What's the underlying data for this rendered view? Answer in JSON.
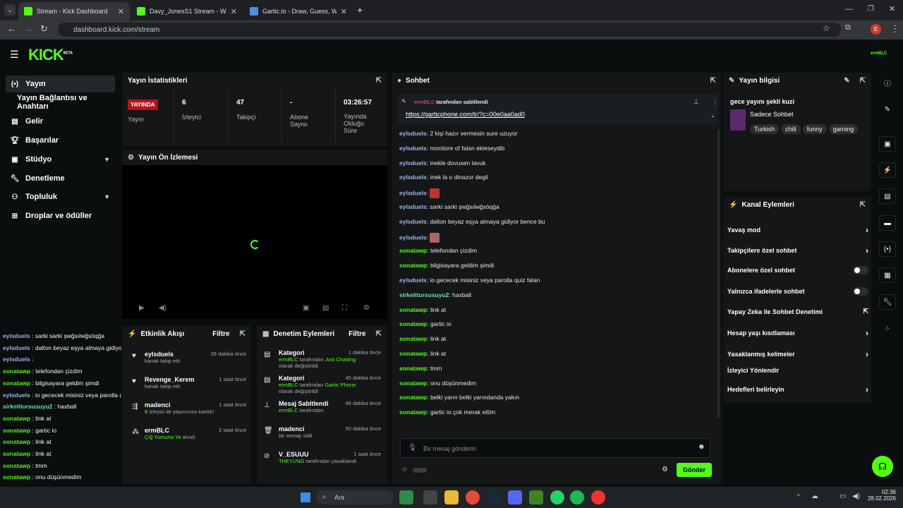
{
  "browser": {
    "tabs": [
      {
        "title": "Stream - Kick Dashboard",
        "color": "#53fc18"
      },
      {
        "title": "Davy_JonesS1 Stream - Watch L",
        "color": "#53fc18"
      },
      {
        "title": "Gartic.io - Draw, Guess, WIN",
        "color": "#4a8fe7"
      }
    ],
    "url": "dashboard.kick.com/stream",
    "profile_initial": "E"
  },
  "kick": {
    "logo": "KICK",
    "beta": "BETA",
    "user_badge": "ermBLC"
  },
  "sidebar": {
    "items": [
      {
        "label": "Yayın",
        "icon": "broadcast-icon"
      },
      {
        "label": "Yayın Bağlantısı ve Anahtarı",
        "icon": ""
      },
      {
        "label": "Gelir",
        "icon": "money-icon"
      },
      {
        "label": "Başarılar",
        "icon": "trophy-icon"
      },
      {
        "label": "Stüdyo",
        "icon": "studio-icon"
      },
      {
        "label": "Denetleme",
        "icon": "wrench-icon"
      },
      {
        "label": "Topluluk",
        "icon": "community-icon"
      },
      {
        "label": "Droplar ve ödüller",
        "icon": "drops-icon"
      }
    ]
  },
  "stats": {
    "title": "Yayın İstatistikleri",
    "status": "YAYINDA",
    "status_label": "Yayın",
    "viewers": "6",
    "viewers_label": "İzleyici",
    "followers": "47",
    "followers_label": "Takipçi",
    "subs": "-",
    "subs_label": "Abone Sayısı",
    "uptime": "03:26:57",
    "uptime_label": "Yayında Olduğu Süre"
  },
  "preview": {
    "title": "Yayın Ön İzlemesi"
  },
  "activity": {
    "title": "Etkinlik Akışı",
    "filter": "Filtre",
    "items": [
      {
        "name": "eylsduels",
        "sub": "kanalı takip etti",
        "time": "28 dakika önce"
      },
      {
        "name": "Revenge_Kerem",
        "sub": "kanalı takip etti",
        "time": "1 saat önce"
      },
      {
        "name": "madenci",
        "sub_num": "8",
        "sub": "izleyici ile yayınınıza katıldı!",
        "time": "1 saat önce"
      },
      {
        "name": "ermBLC",
        "sub_hl": "Çiğ Yumurta Ye",
        "sub": "alındı",
        "time": "2 saat önce"
      }
    ]
  },
  "mod": {
    "title": "Denetim Eylemleri",
    "filter": "Filtre",
    "items": [
      {
        "name": "Kategori",
        "l1_user": "ermBLC",
        "l1": "tarafından",
        "l1_hl": "Just Chatting",
        "l2": "olarak değiştirildi",
        "time": "1 dakika önce"
      },
      {
        "name": "Kategori",
        "l1_user": "ermBLC",
        "l1": "tarafından",
        "l1_hl": "Gartic Phone",
        "l2": "olarak değiştirildi",
        "time": "45 dakika önce"
      },
      {
        "name": "Mesaj Sabitlendi",
        "l1_user": "ermBLC",
        "l1": "tarafından",
        "l1_hl": "",
        "l2": "",
        "time": "48 dakika önce"
      },
      {
        "name": "madenci",
        "l1_user": "",
        "l1": "bir mesajı sildi",
        "l1_hl": "",
        "l2": "",
        "time": "50 dakika önce"
      },
      {
        "name": "V_ESUUU",
        "l1_user": "THEYUNG",
        "l1": "tarafından yasaklandı",
        "l1_hl": "",
        "l2": "",
        "time": "1 saat önce"
      }
    ]
  },
  "chat": {
    "title": "Sohbet",
    "pinned_by": "ermBLC",
    "pinned_text": "tarafından sabitlendi",
    "pinned_link": "https://garticphone.com/tr/?c=00e0aa0ad0",
    "messages": [
      {
        "u": "eylsduels",
        "t": "2 kişi hazır vermesin sure uzuyor",
        "c": "ublue"
      },
      {
        "u": "eylsduels",
        "t": "monitore of falan ekleseydib",
        "c": "ublue"
      },
      {
        "u": "eylsduels",
        "t": "inekle dovusen lavuk",
        "c": "ublue"
      },
      {
        "u": "eylsduels",
        "t": "inek la o dinazor degil",
        "c": "ublue"
      },
      {
        "u": "eylsduels",
        "t": "",
        "c": "ublue",
        "emote": true
      },
      {
        "u": "eylsduels",
        "t": "sarki sarki şwğsılwğsöqğa",
        "c": "ublue"
      },
      {
        "u": "eylsduels",
        "t": "dalton beyaz eşya almaya gidiyor bence bu",
        "c": "ublue"
      },
      {
        "u": "eylsduels",
        "t": "",
        "c": "ublue",
        "emote": true
      },
      {
        "u": "sonatawp",
        "t": "telefondan çizdim",
        "c": "ugreen"
      },
      {
        "u": "sonatawp",
        "t": "bilgisayara geldim şimdi",
        "c": "ugreen"
      },
      {
        "u": "eylsduels",
        "t": "io gececek misiniz veya parolla quiz falan",
        "c": "ublue"
      },
      {
        "u": "sirkelitursusuyu2",
        "t": "haxball",
        "c": "uteal"
      },
      {
        "u": "sonatawp",
        "t": "link at",
        "c": "ugreen"
      },
      {
        "u": "sonatawp",
        "t": "gartic io",
        "c": "ugreen"
      },
      {
        "u": "sonatawp",
        "t": "link at",
        "c": "ugreen"
      },
      {
        "u": "sonatawp",
        "t": "link at",
        "c": "ugreen"
      },
      {
        "u": "sonatawp",
        "t": "tmm",
        "c": "ugreen"
      },
      {
        "u": "sonatawp",
        "t": "onu düşünmedim",
        "c": "ugreen"
      },
      {
        "u": "sonatawp",
        "t": "belki yarın belki yarındanda yakın",
        "c": "ugreen"
      },
      {
        "u": "sonatawp",
        "t": "gartic io çok merak ettim",
        "c": "ugreen"
      }
    ],
    "input_placeholder": "Bir mesaj gönderin",
    "send": "Gönder"
  },
  "overlay": [
    {
      "u": "eylsduels",
      "t": "sarki sarki şwğsılwğsöqğa"
    },
    {
      "u": "eylsduels",
      "t": "dalton beyaz eşya almaya gidiyor bence bu"
    },
    {
      "u": "eylsduels",
      "t": ""
    },
    {
      "u": "sonatawp",
      "t": "telefondan çizdim"
    },
    {
      "u": "sonatawp",
      "t": "bilgisayara geldim şimdi"
    },
    {
      "u": "eylsduels",
      "t": "io gececek misiniz veya parolla quiz falan"
    },
    {
      "u": "sirkelitursusuyu2",
      "t": "haxball"
    },
    {
      "u": "sonatawp",
      "t": "link at"
    },
    {
      "u": "sonatawp",
      "t": "gartic io"
    },
    {
      "u": "sonatawp",
      "t": "link at"
    },
    {
      "u": "sonatawp",
      "t": "link at"
    },
    {
      "u": "sonatawp",
      "t": "tmm"
    },
    {
      "u": "sonatawp",
      "t": "onu düşünmedim"
    },
    {
      "u": "sonatawp",
      "t": "belki yarın belki yarındanda yakın"
    },
    {
      "u": "sonatawp",
      "t": "gartic io çok merak ettim"
    }
  ],
  "info": {
    "title": "Yayın bilgisi",
    "stream_title": "gece yayını şekli kuzi",
    "category": "Sadece Sohbet",
    "tags": [
      "Turkish",
      "chill",
      "funny",
      "gaming"
    ]
  },
  "actions": {
    "title": "Kanal Eylemleri",
    "items": [
      {
        "label": "Yavaş mod",
        "type": "arrow"
      },
      {
        "label": "Takipçilere özel sohbet",
        "type": "arrow"
      },
      {
        "label": "Abonelere özel sohbet",
        "type": "toggle"
      },
      {
        "label": "Yalnızca ifadelerle sohbet",
        "type": "toggle"
      },
      {
        "label": "Yapay Zeka ile Sohbet Denetimi",
        "type": "ext"
      },
      {
        "label": "Hesap yaşı kısıtlaması",
        "type": "arrow"
      },
      {
        "label": "Yasaklanmış kelimeler",
        "type": "arrow"
      },
      {
        "label": "İzleyici Yönlendir",
        "type": "none"
      },
      {
        "label": "Hedefleri belirleyin",
        "type": "arrow"
      }
    ]
  },
  "taskbar": {
    "search": "Ara",
    "time": "02:36",
    "date": "28.02.2026"
  }
}
